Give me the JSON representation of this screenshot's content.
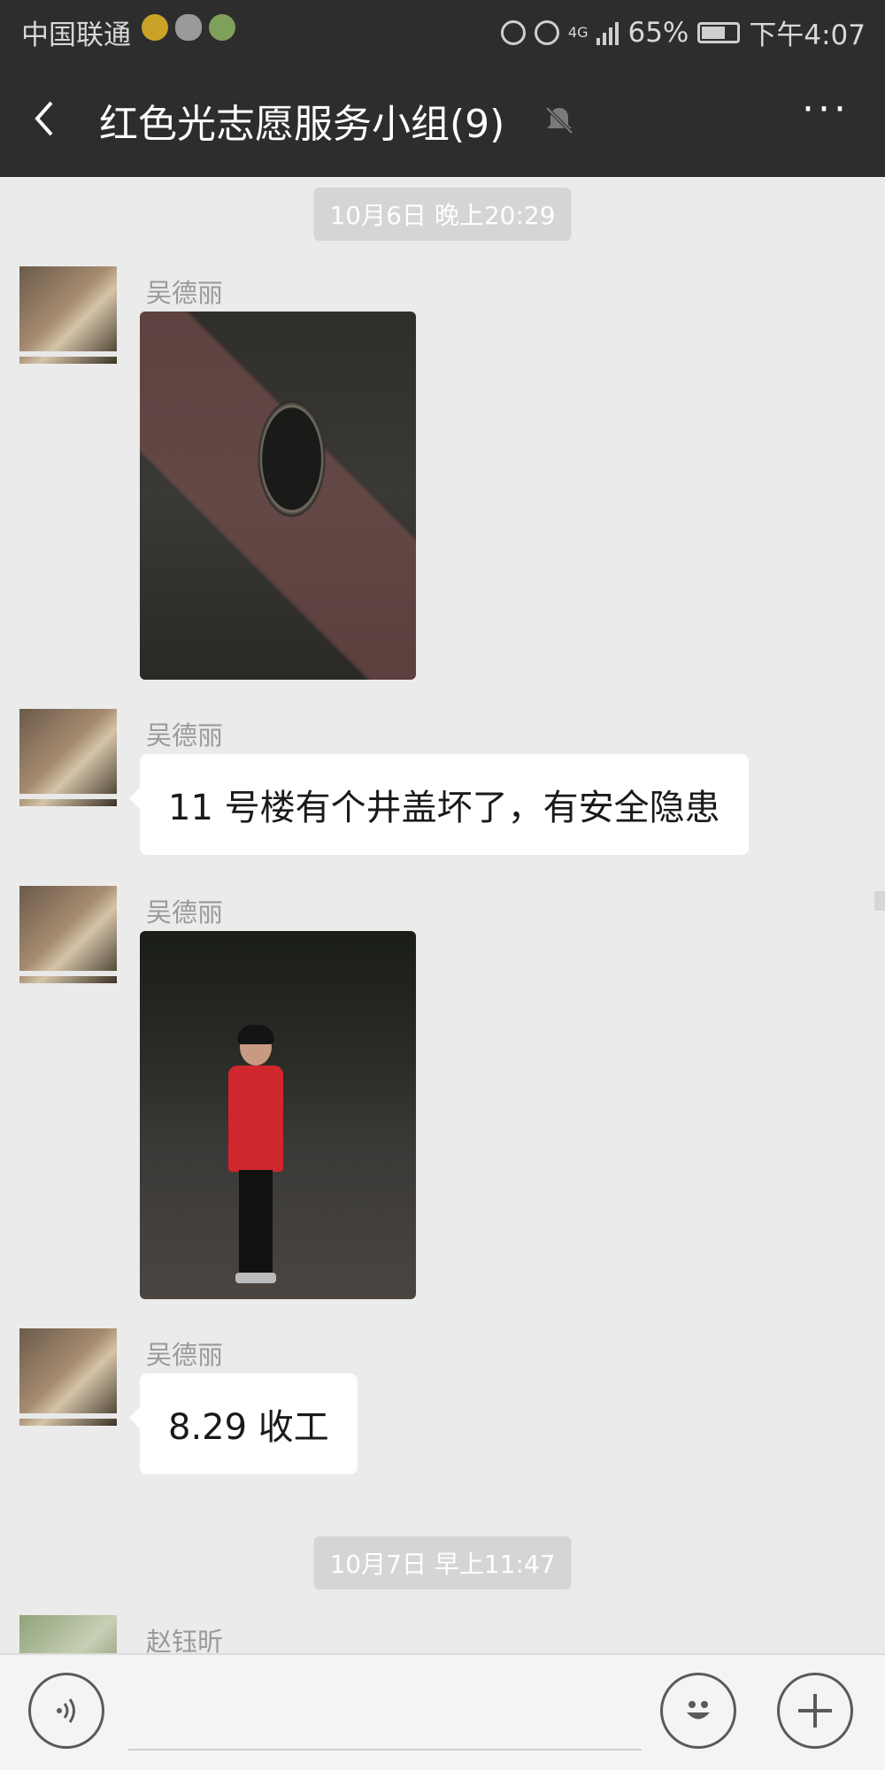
{
  "status_bar": {
    "carrier": "中国联通",
    "battery": "65%",
    "time": "下午4:07",
    "network": "4G",
    "icons": [
      "mail-app-icon",
      "wechat-icon",
      "app-icon",
      "hotspot-icon",
      "alarm-icon",
      "signal-icon",
      "battery-icon"
    ]
  },
  "header": {
    "back_icon": "chevron-left-icon",
    "title": "红色光志愿服务小组(9)",
    "mute_icon": "bell-muted-icon",
    "more_icon": "more-dots-icon",
    "more_label": "···"
  },
  "messages": [
    {
      "type": "time",
      "text": "10月6日 晚上20:29"
    },
    {
      "type": "image",
      "sender": "吴德丽",
      "image_desc": "manhole-photo"
    },
    {
      "type": "text",
      "sender": "吴德丽",
      "text": "11 号楼有个井盖坏了，有安全隐患"
    },
    {
      "type": "image",
      "sender": "吴德丽",
      "image_desc": "volunteer-photo"
    },
    {
      "type": "text",
      "sender": "吴德丽",
      "text": "8.29 收工"
    },
    {
      "type": "time",
      "text": "10月7日 早上11:47"
    },
    {
      "type": "partial",
      "sender": "赵钰昕"
    }
  ],
  "input_bar": {
    "voice_icon": "voice-icon",
    "text_value": "",
    "emoji_icon": "emoji-icon",
    "emoji_label": "☺",
    "plus_icon": "plus-icon",
    "plus_label": "+"
  },
  "colors": {
    "header_bg": "#2d2d2d",
    "chat_bg": "#ebebeb",
    "bubble_bg": "#ffffff",
    "timechip_bg": "#d5d5d5"
  }
}
